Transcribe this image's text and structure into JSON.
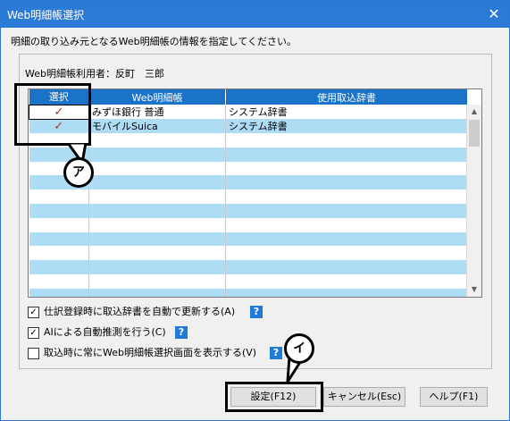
{
  "window": {
    "title": "Web明細帳選択",
    "close_glyph": "✕"
  },
  "description": "明細の取り込み元となるWeb明細帳の情報を指定してください。",
  "user_label": "Web明細帳利用者：反町　三郎",
  "table": {
    "headers": [
      "選択",
      "Web明細帳",
      "使用取込辞書"
    ],
    "rows": [
      {
        "selected": "✓",
        "book": "みずほ銀行 普通",
        "dict": "システム辞書"
      },
      {
        "selected": "✓",
        "book": "モバイルSuica",
        "dict": "システム辞書"
      }
    ]
  },
  "options": [
    {
      "checked": "✓",
      "label": "仕訳登録時に取込辞書を自動で更新する(A)"
    },
    {
      "checked": "✓",
      "label": "AIによる自動推測を行う(C)"
    },
    {
      "checked": "",
      "label": "取込時に常にWeb明細帳選択画面を表示する(V)"
    }
  ],
  "help_glyph": "?",
  "buttons": {
    "ok": "設定(F12)",
    "cancel": "キャンセル(Esc)",
    "help": "ヘルプ(F1)"
  },
  "callouts": {
    "a": "ア",
    "b": "イ"
  },
  "colors": {
    "titlebar": "#2b7bd6",
    "header": "#1a73c9",
    "row_alt": "#aedcf4",
    "check": "#a53a26"
  }
}
